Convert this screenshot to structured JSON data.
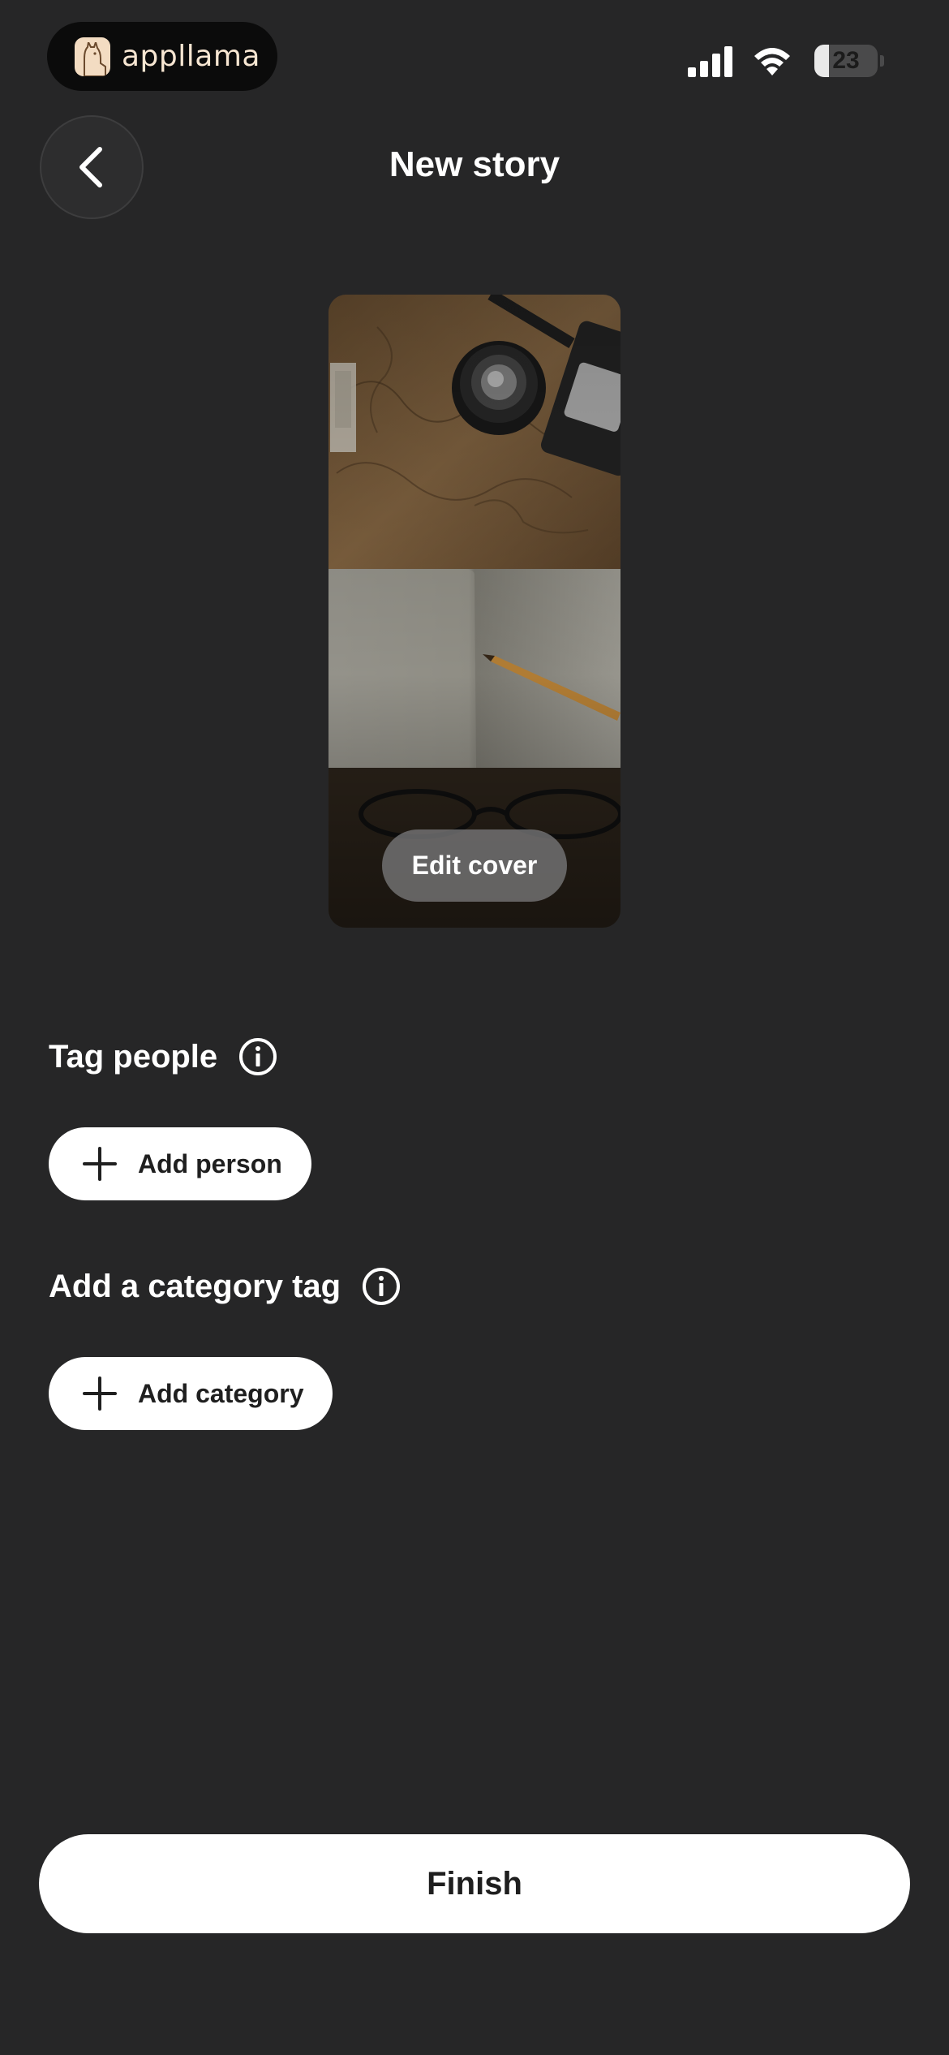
{
  "status_bar": {
    "brand": "appllama",
    "battery_level": "23"
  },
  "header": {
    "title": "New story"
  },
  "cover": {
    "edit_label": "Edit cover"
  },
  "tag_people": {
    "label": "Tag people",
    "add_label": "Add person"
  },
  "category": {
    "label": "Add a category tag",
    "add_label": "Add category"
  },
  "footer": {
    "finish_label": "Finish"
  },
  "colors": {
    "background": "#262627",
    "button": "#ffffff",
    "button_text": "#1f1f1f"
  }
}
